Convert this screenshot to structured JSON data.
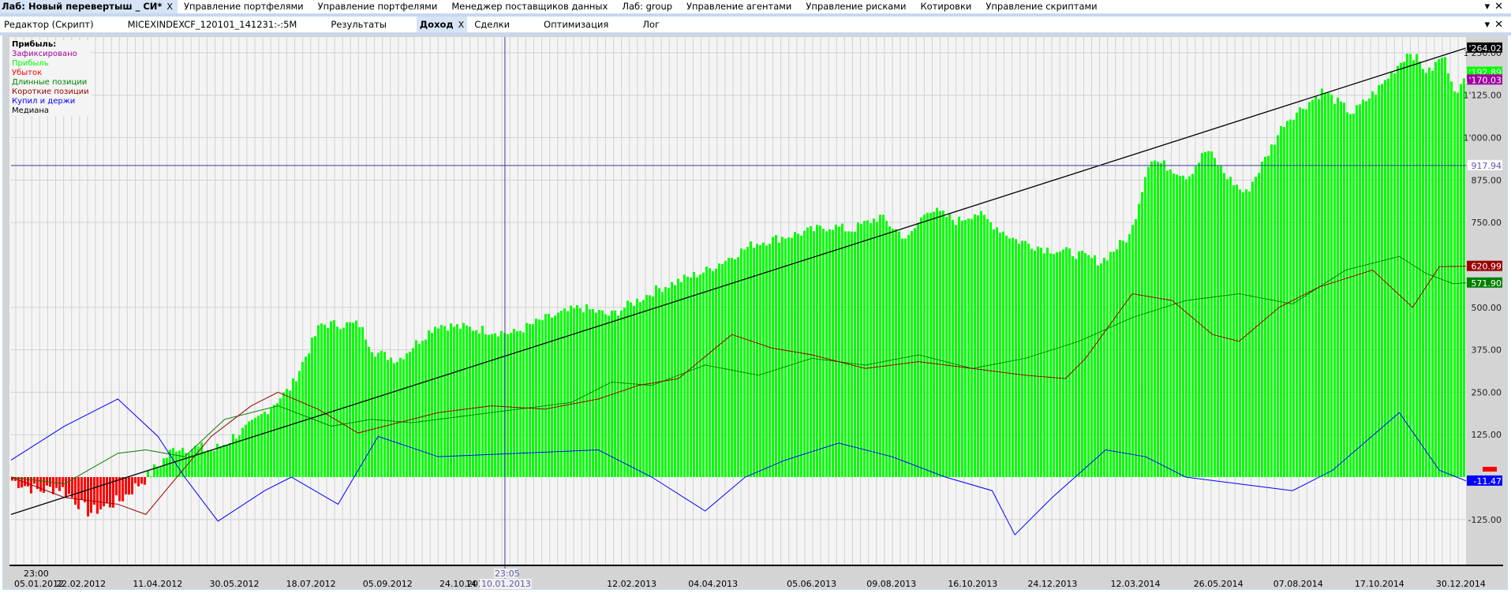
{
  "top_tabs": [
    {
      "label": "Лаб: Новый перевертыш _ СИ*",
      "active": true,
      "closable": true
    },
    {
      "label": "Управление портфелями"
    },
    {
      "label": "Управление портфелями"
    },
    {
      "label": "Менеджер поставщиков данных"
    },
    {
      "label": "Лаб: group"
    },
    {
      "label": "Управление агентами"
    },
    {
      "label": "Управление рисками"
    },
    {
      "label": "Котировки"
    },
    {
      "label": "Управление скриптами"
    }
  ],
  "sub_tabs": [
    {
      "label": "Редактор (Скрипт)"
    },
    {
      "label": "MICEXINDEXCF_120101_141231:-:5M"
    },
    {
      "label": "Результаты"
    },
    {
      "label": "Доход",
      "active": true,
      "closable": true
    },
    {
      "label": "Сделки"
    },
    {
      "label": "Оптимизация"
    },
    {
      "label": "Лог"
    }
  ],
  "close_glyph": "X",
  "window_controls": {
    "menu": "▾",
    "close": "✕"
  },
  "legend": {
    "title": "Прибыль:",
    "items": [
      {
        "label": "Зафиксировано",
        "color": "#a000a0"
      },
      {
        "label": "Прибыль",
        "color": "#00ff00"
      },
      {
        "label": "Убыток",
        "color": "#ff0000"
      },
      {
        "label": "Длинные позиции",
        "color": "#008000"
      },
      {
        "label": "Короткие позиции",
        "color": "#990000"
      },
      {
        "label": "Купил и держи",
        "color": "#0000ff"
      },
      {
        "label": "Медиана",
        "color": "#000000"
      }
    ]
  },
  "chart_data": {
    "type": "bar",
    "title": "Доход",
    "x_unit": "days since 05.01.2012",
    "xlim": [
      0,
      1090
    ],
    "ylim": [
      -260,
      1300
    ],
    "y_ticks": [
      -125,
      125,
      250,
      375,
      500,
      750,
      875,
      1000,
      1125,
      1250
    ],
    "y_tick_labels": [
      "-125.00",
      "125.00",
      "250.00",
      "375.00",
      "500.00",
      "750.00",
      "875.00",
      "1'000.00",
      "1'125.00",
      "1'250.00"
    ],
    "x_tick_labels": [
      {
        "day": 0,
        "label": "05.01.2012",
        "time": "23:00"
      },
      {
        "day": 48,
        "label": "22.02.2012"
      },
      {
        "day": 97,
        "label": "11.04.2012"
      },
      {
        "day": 146,
        "label": "30.05.2012"
      },
      {
        "day": 195,
        "label": "18.07.2012"
      },
      {
        "day": 244,
        "label": "05.09.2012"
      },
      {
        "day": 293,
        "label": "24.10.2012"
      },
      {
        "day": 400,
        "label": "12.02.2013"
      },
      {
        "day": 452,
        "label": "04.04.2013"
      },
      {
        "day": 515,
        "label": "05.06.2013"
      },
      {
        "day": 566,
        "label": "09.08.2013"
      },
      {
        "day": 618,
        "label": "16.10.2013"
      },
      {
        "day": 669,
        "label": "24.12.2013"
      },
      {
        "day": 722,
        "label": "12.03.2014"
      },
      {
        "day": 775,
        "label": "26.05.2014"
      },
      {
        "day": 826,
        "label": "07.08.2014"
      },
      {
        "day": 878,
        "label": "17.10.2014"
      },
      {
        "day": 930,
        "label": "30.12.2014"
      }
    ],
    "crosshair": {
      "day": 370,
      "value": 917.94,
      "date_label": "10.01.2013",
      "time_label": "23:05",
      "value_label": "917.94",
      "hidden_label_fragment": "14"
    },
    "equity": [
      [
        0,
        -10
      ],
      [
        20,
        -40
      ],
      [
        36,
        -30
      ],
      [
        58,
        -105
      ],
      [
        80,
        -70
      ],
      [
        101,
        0
      ],
      [
        123,
        90
      ],
      [
        152,
        80
      ],
      [
        181,
        160
      ],
      [
        209,
        265
      ],
      [
        231,
        450
      ],
      [
        260,
        450
      ],
      [
        271,
        370
      ],
      [
        289,
        345
      ],
      [
        318,
        450
      ],
      [
        347,
        437
      ],
      [
        375,
        423
      ],
      [
        397,
        463
      ],
      [
        426,
        500
      ],
      [
        448,
        476
      ],
      [
        484,
        555
      ],
      [
        520,
        608
      ],
      [
        556,
        688
      ],
      [
        585,
        714
      ],
      [
        614,
        740
      ],
      [
        628,
        727
      ],
      [
        650,
        767
      ],
      [
        671,
        700
      ],
      [
        686,
        793
      ],
      [
        708,
        753
      ],
      [
        722,
        780
      ],
      [
        751,
        700
      ],
      [
        773,
        674
      ],
      [
        794,
        661
      ],
      [
        816,
        635
      ],
      [
        838,
        714
      ],
      [
        852,
        940
      ],
      [
        881,
        886
      ],
      [
        895,
        966
      ],
      [
        910,
        886
      ],
      [
        924,
        833
      ],
      [
        939,
        940
      ],
      [
        953,
        1045
      ],
      [
        982,
        1138
      ],
      [
        1004,
        1071
      ],
      [
        1025,
        1150
      ],
      [
        1047,
        1256
      ],
      [
        1061,
        1190
      ],
      [
        1072,
        1243
      ],
      [
        1083,
        1124
      ],
      [
        1090,
        1193
      ]
    ],
    "series": [
      {
        "name": "Длинные позиции",
        "color": "#008000",
        "points": [
          [
            0,
            0
          ],
          [
            40,
            -20
          ],
          [
            80,
            70
          ],
          [
            101,
            80
          ],
          [
            130,
            60
          ],
          [
            160,
            170
          ],
          [
            200,
            210
          ],
          [
            240,
            150
          ],
          [
            270,
            170
          ],
          [
            300,
            160
          ],
          [
            340,
            180
          ],
          [
            380,
            200
          ],
          [
            420,
            220
          ],
          [
            450,
            280
          ],
          [
            480,
            270
          ],
          [
            520,
            330
          ],
          [
            560,
            300
          ],
          [
            600,
            350
          ],
          [
            640,
            330
          ],
          [
            680,
            360
          ],
          [
            720,
            320
          ],
          [
            760,
            350
          ],
          [
            800,
            400
          ],
          [
            840,
            470
          ],
          [
            880,
            520
          ],
          [
            920,
            540
          ],
          [
            960,
            510
          ],
          [
            1000,
            610
          ],
          [
            1040,
            650
          ],
          [
            1060,
            600
          ],
          [
            1080,
            570
          ],
          [
            1090,
            572
          ]
        ]
      },
      {
        "name": "Короткие позиции",
        "color": "#990000",
        "points": [
          [
            0,
            0
          ],
          [
            40,
            -60
          ],
          [
            80,
            -80
          ],
          [
            101,
            -110
          ],
          [
            120,
            -20
          ],
          [
            150,
            120
          ],
          [
            180,
            210
          ],
          [
            200,
            250
          ],
          [
            230,
            200
          ],
          [
            260,
            130
          ],
          [
            290,
            160
          ],
          [
            320,
            190
          ],
          [
            360,
            210
          ],
          [
            400,
            200
          ],
          [
            440,
            230
          ],
          [
            470,
            270
          ],
          [
            500,
            290
          ],
          [
            540,
            420
          ],
          [
            570,
            380
          ],
          [
            600,
            360
          ],
          [
            640,
            320
          ],
          [
            680,
            340
          ],
          [
            720,
            320
          ],
          [
            760,
            300
          ],
          [
            790,
            290
          ],
          [
            805,
            350
          ],
          [
            840,
            540
          ],
          [
            870,
            520
          ],
          [
            900,
            420
          ],
          [
            920,
            400
          ],
          [
            950,
            500
          ],
          [
            980,
            560
          ],
          [
            1020,
            610
          ],
          [
            1050,
            500
          ],
          [
            1070,
            620
          ],
          [
            1090,
            621
          ]
        ]
      },
      {
        "name": "Купил и держи",
        "color": "#0000ff",
        "points": [
          [
            0,
            50
          ],
          [
            40,
            150
          ],
          [
            80,
            230
          ],
          [
            110,
            120
          ],
          [
            130,
            0
          ],
          [
            155,
            -130
          ],
          [
            190,
            -40
          ],
          [
            210,
            0
          ],
          [
            245,
            -80
          ],
          [
            275,
            120
          ],
          [
            320,
            60
          ],
          [
            380,
            70
          ],
          [
            440,
            80
          ],
          [
            480,
            0
          ],
          [
            520,
            -100
          ],
          [
            550,
            0
          ],
          [
            580,
            50
          ],
          [
            620,
            100
          ],
          [
            660,
            60
          ],
          [
            700,
            0
          ],
          [
            735,
            -40
          ],
          [
            752,
            -170
          ],
          [
            780,
            -60
          ],
          [
            820,
            80
          ],
          [
            850,
            60
          ],
          [
            880,
            0
          ],
          [
            920,
            -20
          ],
          [
            960,
            -40
          ],
          [
            990,
            20
          ],
          [
            1040,
            190
          ],
          [
            1070,
            20
          ],
          [
            1090,
            -11
          ]
        ]
      },
      {
        "name": "Медиана",
        "color": "#000000",
        "points": [
          [
            0,
            -110
          ],
          [
            1090,
            1264
          ]
        ]
      }
    ],
    "markers": [
      {
        "label": "1'264.02",
        "value": 1264.02,
        "bg": "#000000",
        "fg": "#ffffff"
      },
      {
        "label": "1'192.89",
        "value": 1192.89,
        "bg": "#00ff00",
        "fg": "#ffffff"
      },
      {
        "label": "1'170.03",
        "value": 1170.03,
        "bg": "#a000a0",
        "fg": "#ffffff"
      },
      {
        "label": "620.99",
        "value": 620.99,
        "bg": "#990000",
        "fg": "#ffffff"
      },
      {
        "label": "571.90",
        "value": 571.9,
        "bg": "#008000",
        "fg": "#ffffff"
      },
      {
        "label": "-11.47",
        "value": -11.47,
        "bg": "#0000ff",
        "fg": "#ffffff"
      }
    ]
  }
}
